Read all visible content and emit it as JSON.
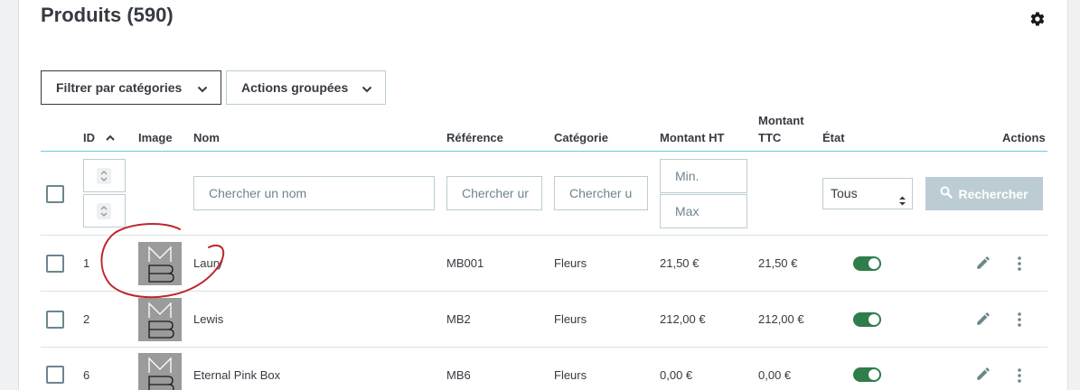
{
  "page": {
    "title": "Produits (590)"
  },
  "toolbar": {
    "filter_label": "Filtrer par catégories",
    "actions_label": "Actions groupées"
  },
  "table": {
    "headers": {
      "id": "ID",
      "image": "Image",
      "name": "Nom",
      "reference": "Référence",
      "category": "Catégorie",
      "amount_ht": "Montant HT",
      "amount_ttc_line1": "Montant",
      "amount_ttc_line2": "TTC",
      "status": "État",
      "actions": "Actions"
    },
    "filters": {
      "name_placeholder": "Chercher un nom",
      "reference_placeholder": "Chercher ur",
      "category_placeholder": "Chercher u",
      "min_placeholder": "Min.",
      "max_placeholder": "Max",
      "status_selected": "Tous",
      "search_button": "Rechercher"
    },
    "rows": [
      {
        "id": "1",
        "name": "Laury",
        "reference": "MB001",
        "category": "Fleurs",
        "amount_ht": "21,50 €",
        "amount_ttc": "21,50 €",
        "active": true
      },
      {
        "id": "2",
        "name": "Lewis",
        "reference": "MB2",
        "category": "Fleurs",
        "amount_ht": "212,00 €",
        "amount_ttc": "212,00 €",
        "active": true
      },
      {
        "id": "6",
        "name": "Eternal Pink Box",
        "reference": "MB6",
        "category": "Fleurs",
        "amount_ht": "0,00 €",
        "amount_ttc": "0,00 €",
        "active": true
      }
    ]
  },
  "colors": {
    "toggle_on": "#2e7d4a",
    "accent": "#25b9d7",
    "annotation": "#c0262d"
  },
  "icons": [
    "gear-icon",
    "chevron-down-icon",
    "sort-asc-icon",
    "spin-arrows-icon",
    "search-icon",
    "pencil-icon",
    "kebab-icon"
  ]
}
